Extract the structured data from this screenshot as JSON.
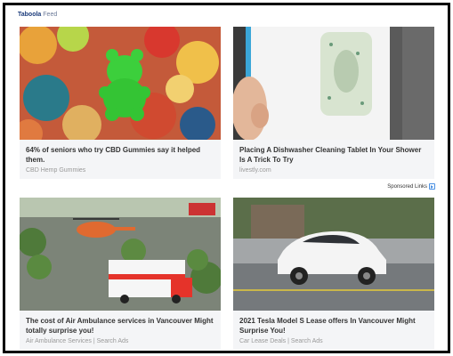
{
  "feed": {
    "brand": "Taboola",
    "suffix": "Feed"
  },
  "sponsored": {
    "label": "Sponsored Links"
  },
  "cards": [
    {
      "headline": "64% of seniors who try CBD Gummies say it helped them.",
      "source": "CBD Hemp Gummies",
      "image_icon": "gummy-bear-photo"
    },
    {
      "headline": "Placing A Dishwasher Cleaning Tablet In Your Shower Is A Trick To Try",
      "source": "livestly.com",
      "image_icon": "sponge-photo"
    },
    {
      "headline": "The cost of Air Ambulance services in Vancouver Might totally surprise you!",
      "source": "Air Ambulance Services | Search Ads",
      "image_icon": "ambulance-helicopter-photo"
    },
    {
      "headline": "2021 Tesla Model S Lease offers In Vancouver Might Surprise You!",
      "source": "Car Lease Deals | Search Ads",
      "image_icon": "white-car-photo"
    }
  ]
}
